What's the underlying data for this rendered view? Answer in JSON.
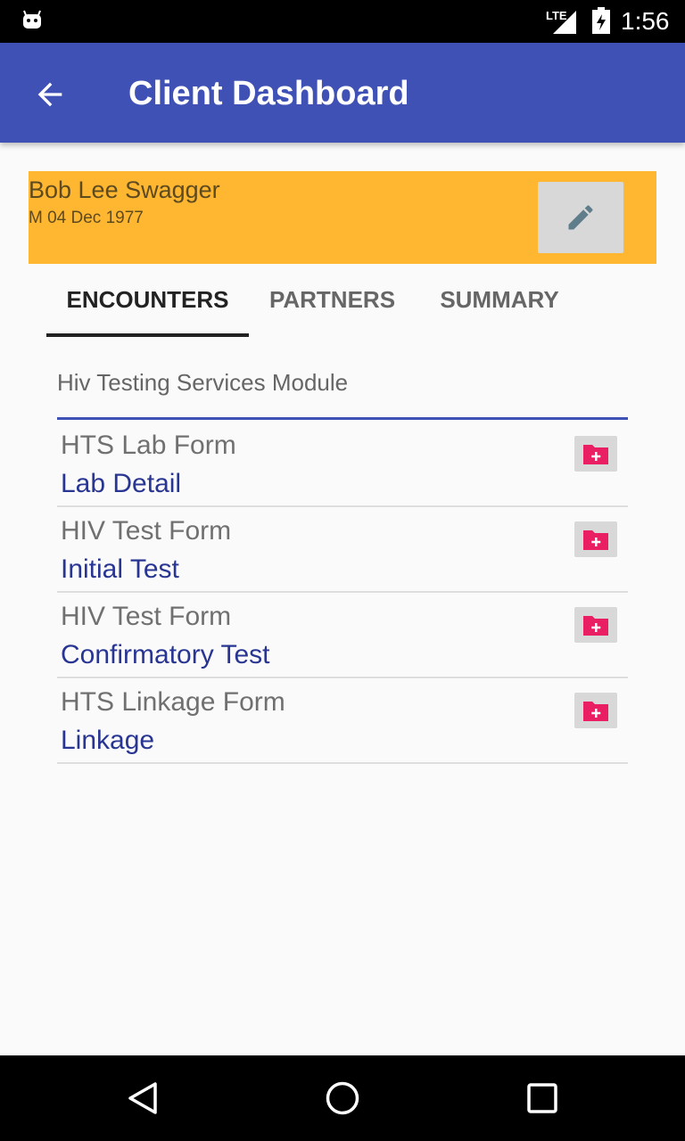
{
  "status_bar": {
    "network": "LTE",
    "time": "1:56",
    "icons": [
      "android-icon",
      "signal-icon",
      "battery-icon"
    ]
  },
  "app_bar": {
    "title": "Client Dashboard",
    "back_icon": "arrow-back-icon",
    "color": "#3f51b5"
  },
  "client": {
    "name": "Bob Lee Swagger",
    "sex_dob": "M  04 Dec 1977",
    "edit_icon": "pencil-icon",
    "card_color": "#ffb732"
  },
  "tabs": [
    {
      "label": "ENCOUNTERS",
      "active": true
    },
    {
      "label": "PARTNERS",
      "active": false
    },
    {
      "label": "SUMMARY",
      "active": false
    }
  ],
  "module": {
    "title": "Hiv Testing Services Module",
    "encounters": [
      {
        "form": "HTS Lab Form",
        "label": "Lab Detail",
        "icon": "folder-add-icon"
      },
      {
        "form": "HIV Test Form",
        "label": "Initial Test",
        "icon": "folder-add-icon"
      },
      {
        "form": "HIV Test Form",
        "label": "Confirmatory Test",
        "icon": "folder-add-icon"
      },
      {
        "form": "HTS Linkage Form",
        "label": "Linkage",
        "icon": "folder-add-icon"
      }
    ]
  },
  "nav_bar": {
    "icons": [
      "back-triangle-icon",
      "home-circle-icon",
      "recents-square-icon"
    ]
  }
}
